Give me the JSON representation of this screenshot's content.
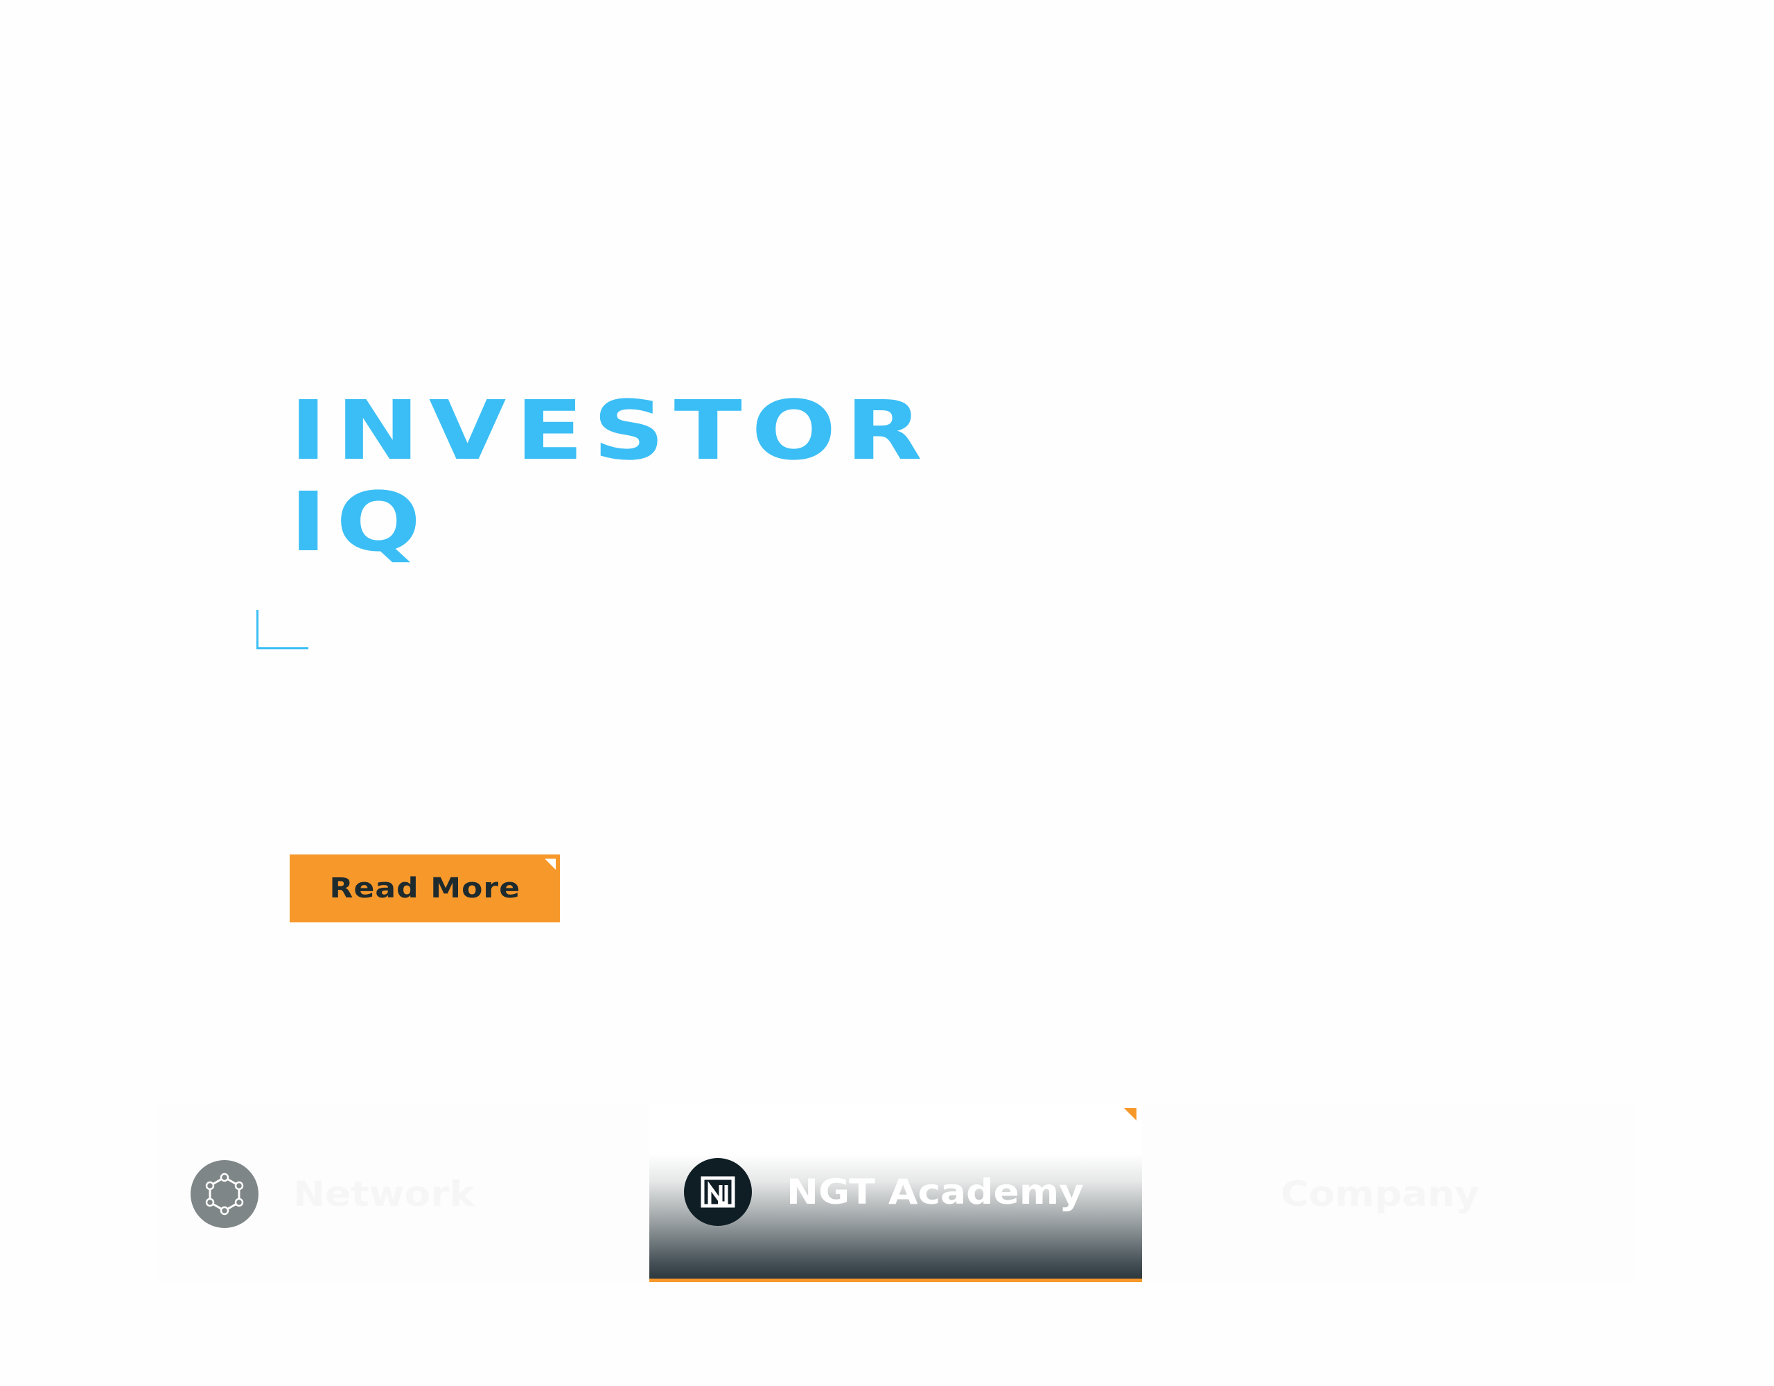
{
  "hero": {
    "title_line1": "INVESTOR",
    "title_line2": "IQ",
    "read_more_label": "Read More"
  },
  "tabs": [
    {
      "label": "Network",
      "icon": "network-nodes-icon",
      "active": false
    },
    {
      "label": "NGT Academy",
      "icon": "ngt-logo-icon",
      "active": true
    },
    {
      "label": "Company",
      "icon": "",
      "active": false
    }
  ],
  "colors": {
    "accent_blue": "#3bbef5",
    "accent_orange": "#f7982b",
    "dark": "#0f1e24"
  }
}
